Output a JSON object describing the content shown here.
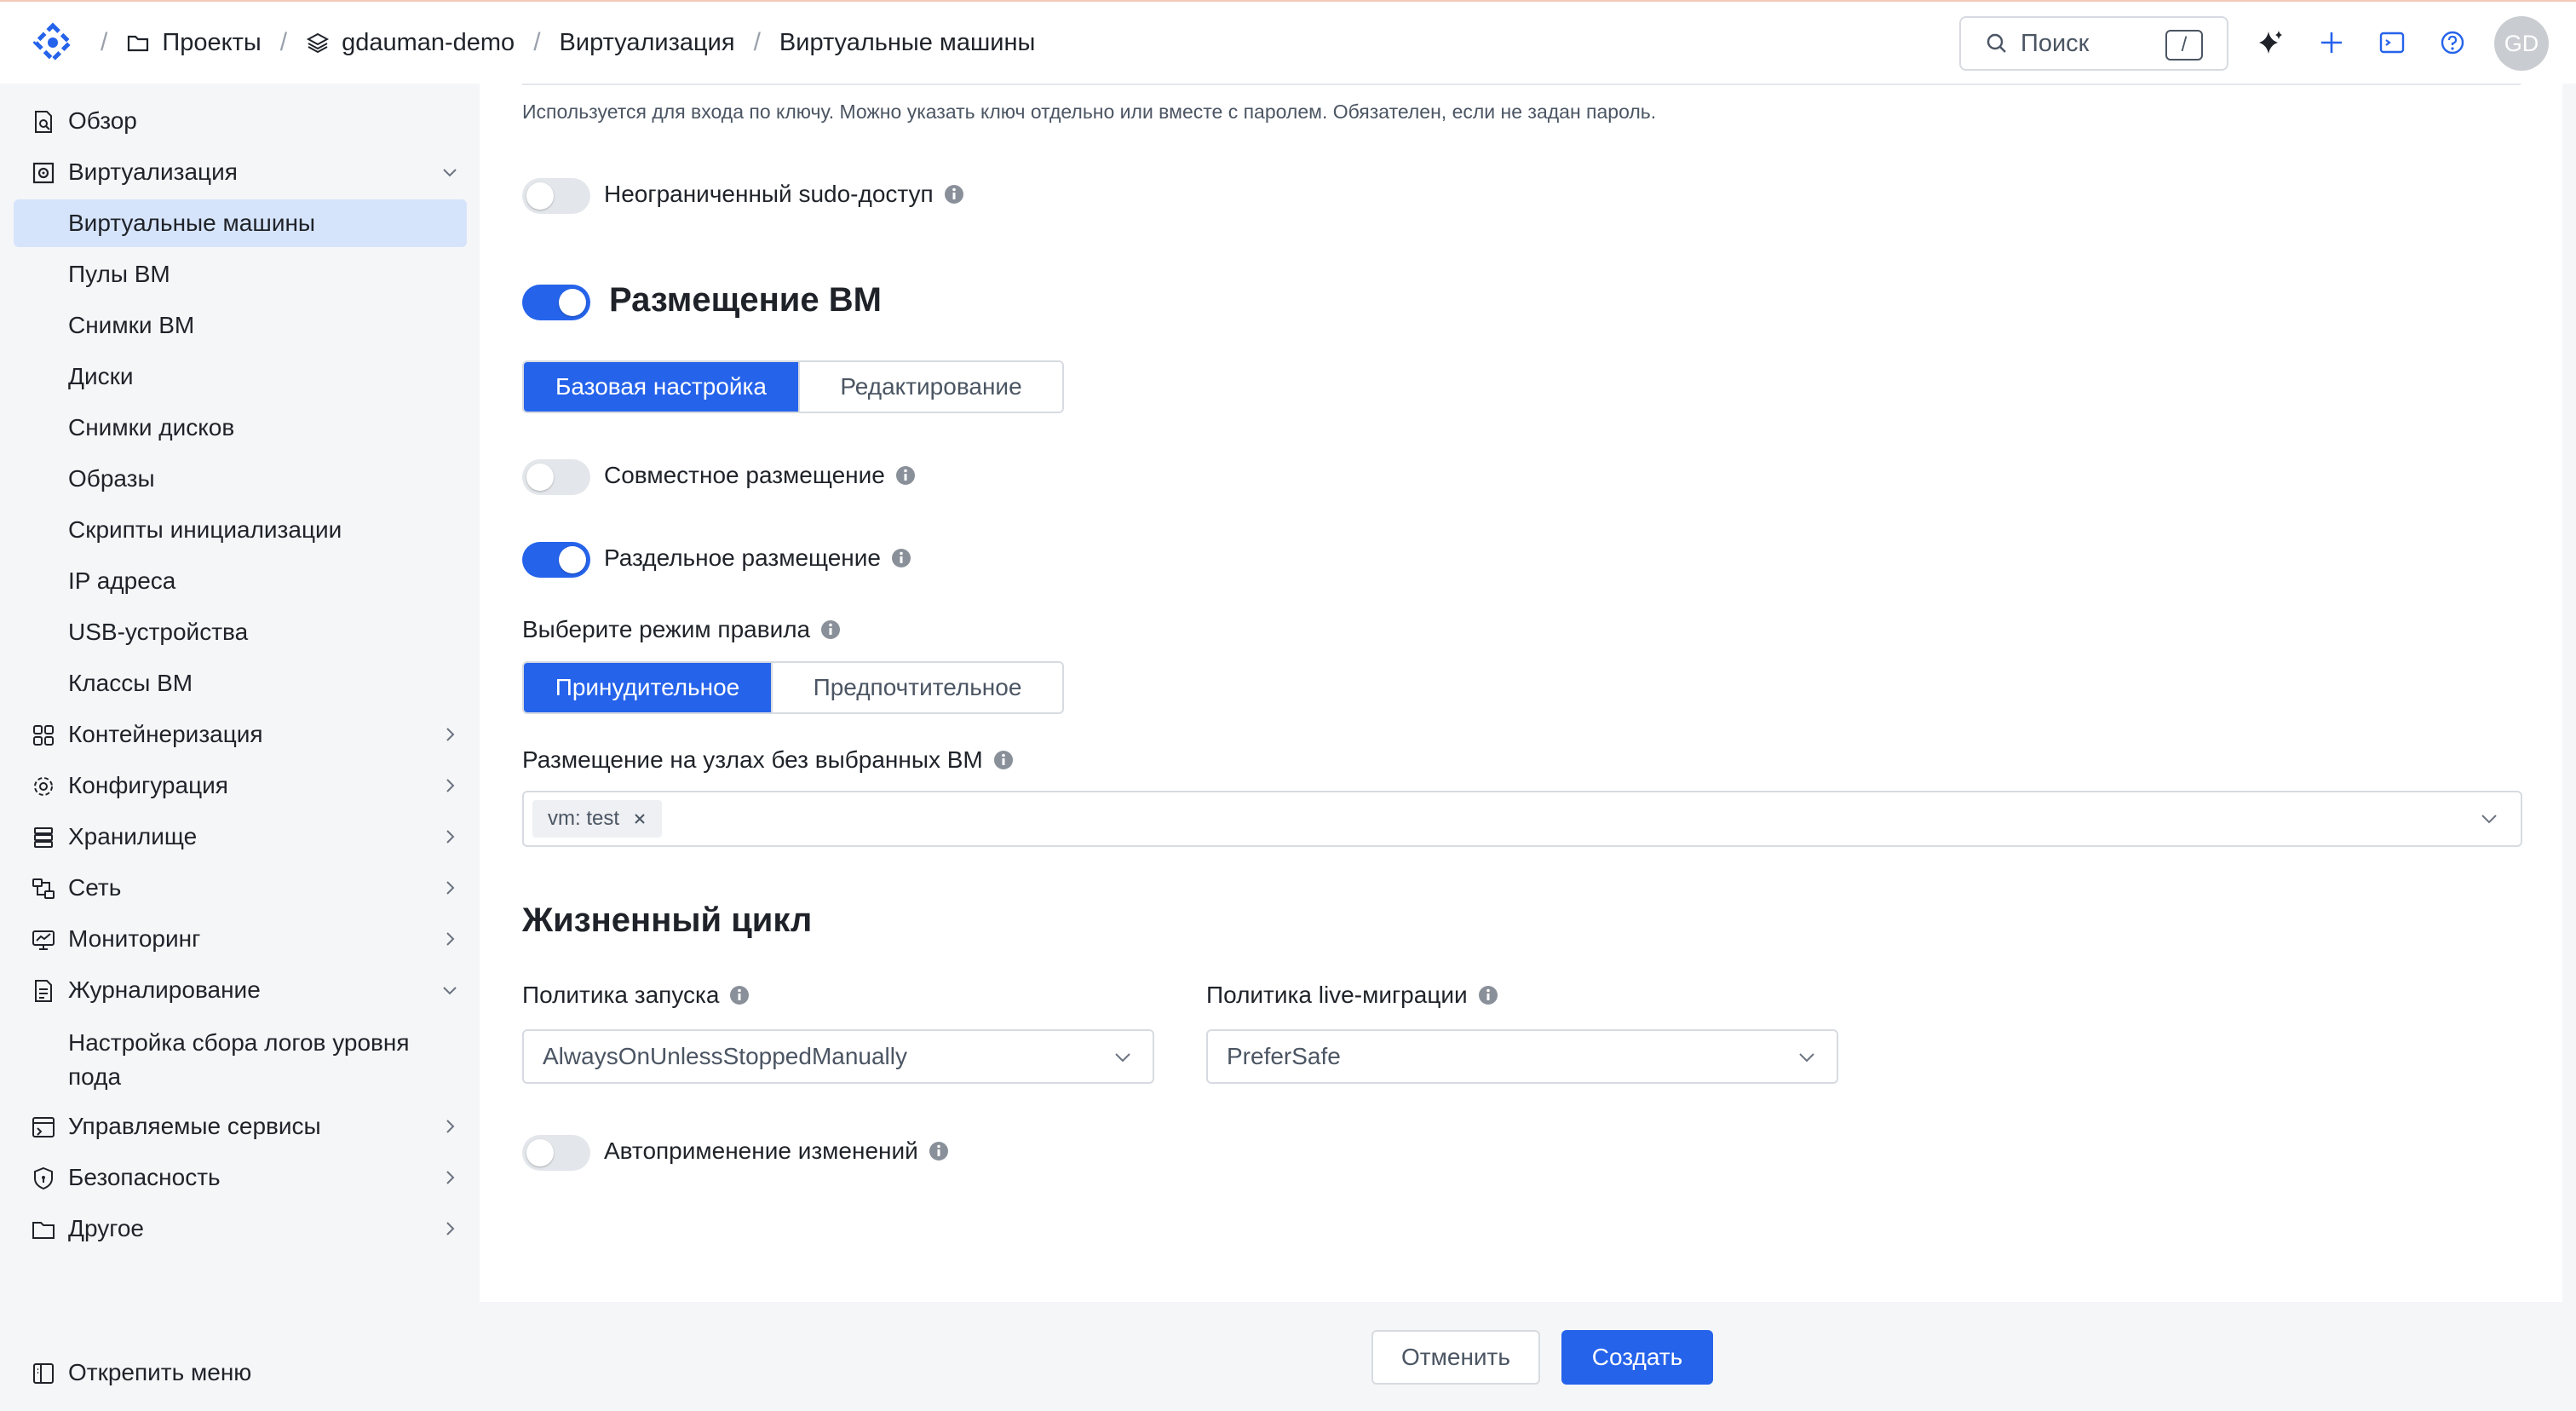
{
  "colors": {
    "accent": "#2563eb",
    "active_nav_bg": "#d6e4fb",
    "toggle_off": "#e3e6ea"
  },
  "header": {
    "breadcrumbs": [
      {
        "label": "Проекты",
        "icon": "folder-icon"
      },
      {
        "label": "gdauman-demo",
        "icon": "layers-icon"
      },
      {
        "label": "Виртуализация"
      },
      {
        "label": "Виртуальные машины"
      }
    ],
    "search": {
      "placeholder": "Поиск",
      "shortcut": "/"
    },
    "icons": [
      "sparkle-icon",
      "plus-icon",
      "terminal-icon",
      "help-icon"
    ],
    "avatar": "GD"
  },
  "sidebar": {
    "items": [
      {
        "label": "Обзор",
        "icon": "overview-icon"
      },
      {
        "label": "Виртуализация",
        "icon": "virtualization-icon",
        "expanded": true
      },
      {
        "label": "Виртуальные машины",
        "active": true
      },
      {
        "label": "Пулы ВМ"
      },
      {
        "label": "Снимки ВМ"
      },
      {
        "label": "Диски"
      },
      {
        "label": "Снимки дисков"
      },
      {
        "label": "Образы"
      },
      {
        "label": "Скрипты инициализации"
      },
      {
        "label": "IP адреса"
      },
      {
        "label": "USB-устройства"
      },
      {
        "label": "Классы ВМ"
      },
      {
        "label": "Контейнеризация",
        "icon": "grid-icon"
      },
      {
        "label": "Конфигурация",
        "icon": "gear-icon"
      },
      {
        "label": "Хранилище",
        "icon": "storage-icon"
      },
      {
        "label": "Сеть",
        "icon": "network-icon"
      },
      {
        "label": "Мониторинг",
        "icon": "monitor-icon"
      },
      {
        "label": "Журналирование",
        "icon": "log-icon",
        "expanded": true
      },
      {
        "label": "Настройка сбора логов уровня пода"
      },
      {
        "label": "Управляемые сервисы",
        "icon": "services-icon"
      },
      {
        "label": "Безопасность",
        "icon": "shield-icon"
      },
      {
        "label": "Другое",
        "icon": "folder-icon"
      }
    ],
    "unpin": "Открепить меню"
  },
  "form": {
    "key_hint": "Используется для входа по ключу. Можно указать ключ отдельно или вместе с паролем. Обязателен, если не задан пароль.",
    "sudo_label": "Неограниченный sudo-доступ",
    "sudo_on": false,
    "placement": {
      "title": "Размещение ВМ",
      "enabled": true,
      "tabs": [
        "Базовая настройка",
        "Редактирование"
      ],
      "active_tab": "Базовая настройка",
      "affinity_label": "Совместное размещение",
      "affinity_on": false,
      "anti_affinity_label": "Раздельное размещение",
      "anti_affinity_on": true,
      "rule_mode_label": "Выберите режим правила",
      "rule_modes": [
        "Принудительное",
        "Предпочтительное"
      ],
      "active_rule_mode": "Принудительное",
      "nodes_label": "Размещение на узлах без выбранных ВМ",
      "selected_tags": [
        "vm: test"
      ]
    },
    "lifecycle": {
      "title": "Жизненный цикл",
      "run_policy_label": "Политика запуска",
      "run_policy_value": "AlwaysOnUnlessStoppedManually",
      "migration_policy_label": "Политика live-миграции",
      "migration_policy_value": "PreferSafe",
      "auto_apply_label": "Автоприменение изменений",
      "auto_apply_on": false
    }
  },
  "footer": {
    "cancel": "Отменить",
    "create": "Создать"
  }
}
